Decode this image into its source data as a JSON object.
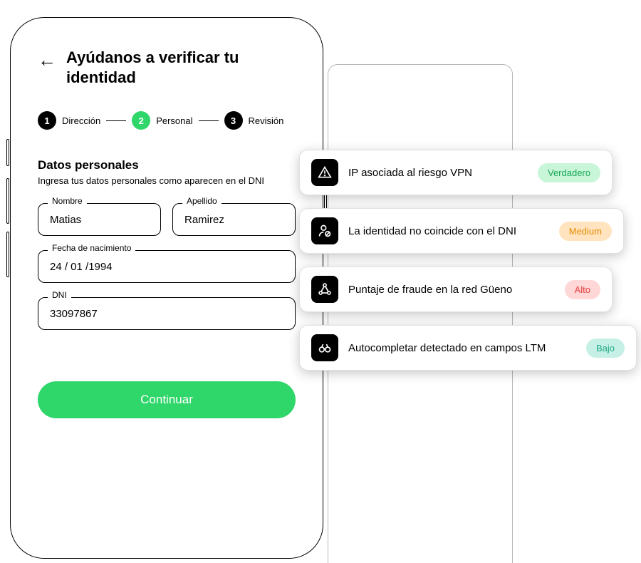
{
  "header": {
    "title": "Ayúdanos a verificar tu identidad"
  },
  "stepper": {
    "steps": [
      {
        "num": "1",
        "label": "Dirección"
      },
      {
        "num": "2",
        "label": "Personal"
      },
      {
        "num": "3",
        "label": "Revisión"
      }
    ]
  },
  "section": {
    "title": "Datos personales",
    "desc": "Ingresa tus datos personales como aparecen en el DNI"
  },
  "fields": {
    "nombre": {
      "label": "Nombre",
      "value": "Matias"
    },
    "apellido": {
      "label": "Apellido",
      "value": "Ramirez"
    },
    "fecha": {
      "label": "Fecha de nacimiento",
      "value": "24 / 01 /1994"
    },
    "dni": {
      "label": "DNI",
      "value": "33097867"
    }
  },
  "button": {
    "continue": "Continuar"
  },
  "cards": [
    {
      "title": "IP asociada al riesgo VPN",
      "badge": "Verdadero",
      "badgeClass": "badge-green",
      "icon": "alert"
    },
    {
      "title": "La identidad no coincide con el DNI",
      "badge": "Medium",
      "badgeClass": "badge-orange",
      "icon": "person"
    },
    {
      "title": "Puntaje de fraude en la red Güeno",
      "badge": "Alto",
      "badgeClass": "badge-red",
      "icon": "network"
    },
    {
      "title": "Autocompletar detectado en campos LTM",
      "badge": "Bajo",
      "badgeClass": "badge-teal",
      "icon": "binoculars"
    }
  ]
}
